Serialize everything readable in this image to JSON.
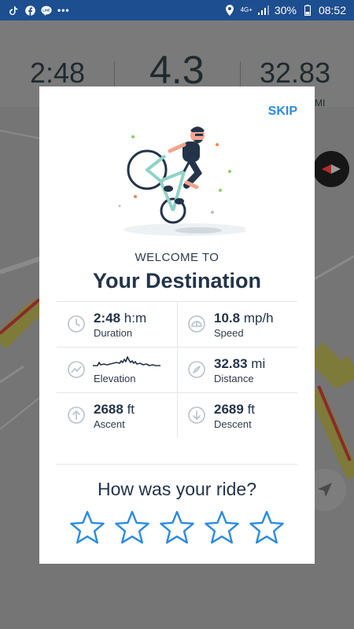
{
  "status_bar": {
    "left_icons": [
      "tiktok-icon",
      "facebook-icon",
      "line-icon",
      "more-dots-icon"
    ],
    "network": "4G+",
    "battery": "30%",
    "time": "08:52"
  },
  "background": {
    "time": "2:48",
    "speed": "4.3",
    "distance": "32.83",
    "distance_unit": "MI"
  },
  "modal": {
    "skip_label": "SKIP",
    "welcome": "WELCOME TO",
    "destination": "Your Destination",
    "stats": {
      "duration": {
        "value": "2:48",
        "unit": "h:m",
        "label": "Duration"
      },
      "speed": {
        "value": "10.8",
        "unit": "mp/h",
        "label": "Speed"
      },
      "elevation": {
        "label": "Elevation"
      },
      "distance": {
        "value": "32.83",
        "unit": "mi",
        "label": "Distance"
      },
      "ascent": {
        "value": "2688",
        "unit": "ft",
        "label": "Ascent"
      },
      "descent": {
        "value": "2689",
        "unit": "ft",
        "label": "Descent"
      }
    },
    "rating_question": "How was your ride?",
    "rating": {
      "max": 5,
      "selected": 0
    }
  },
  "colors": {
    "accent": "#2c8be0",
    "text_dark": "#23344a",
    "status_bar": "#1d4e8f"
  }
}
